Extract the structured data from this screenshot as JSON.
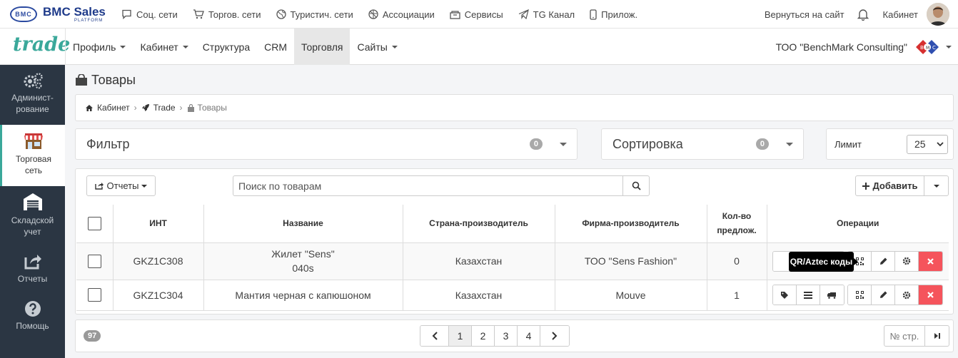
{
  "topbar": {
    "brand": "BMC Sales",
    "brand_sub": "PLATFORM",
    "brand_badge": "BMC",
    "nav": [
      {
        "label": "Соц. сети",
        "icon": "chat-icon"
      },
      {
        "label": "Торгов. сети",
        "icon": "cart-icon"
      },
      {
        "label": "Туристич. сети",
        "icon": "globe-icon"
      },
      {
        "label": "Ассоциации",
        "icon": "network-icon"
      },
      {
        "label": "Сервисы",
        "icon": "box-icon"
      },
      {
        "label": "TG Канал",
        "icon": "telegram-icon"
      },
      {
        "label": "Прилож.",
        "icon": "phone-icon"
      }
    ],
    "back_to_site": "Вернуться на сайт",
    "cabinet": "Кабинет"
  },
  "mainnav": {
    "logo": "trade",
    "tabs": [
      {
        "label": "Профиль",
        "dropdown": true
      },
      {
        "label": "Кабинет",
        "dropdown": true
      },
      {
        "label": "Структура",
        "dropdown": false
      },
      {
        "label": "CRM",
        "dropdown": false
      },
      {
        "label": "Торговля",
        "dropdown": false,
        "active": true
      },
      {
        "label": "Сайты",
        "dropdown": true
      }
    ],
    "company": "ТОО \"BenchMark Consulting\"",
    "company_logo": "B M C"
  },
  "sidebar": {
    "items": [
      {
        "label": "Админист-рование",
        "icon": "gears-icon"
      },
      {
        "label": "Торговая сеть",
        "icon": "store-icon",
        "active": true
      },
      {
        "label": "Складской учет",
        "icon": "warehouse-icon"
      },
      {
        "label": "Отчеты",
        "icon": "share-icon"
      },
      {
        "label": "Помощь",
        "icon": "help-icon"
      }
    ]
  },
  "page": {
    "title": "Товары",
    "breadcrumb": [
      "Кабинет",
      "Trade",
      "Товары"
    ]
  },
  "filter": {
    "label": "Фильтр",
    "count": "0"
  },
  "sort": {
    "label": "Сортировка",
    "count": "0"
  },
  "limit": {
    "label": "Лимит",
    "value": "25"
  },
  "toolbar": {
    "reports": "Отчеты",
    "search_placeholder": "Поиск по товарам",
    "add": "Добавить"
  },
  "table": {
    "headers": [
      "ИНТ",
      "Название",
      "Страна-производитель",
      "Фирма-производитель",
      "Кол-во предлож.",
      "Операции"
    ],
    "rows": [
      {
        "int": "GKZ1C308",
        "name": "Жилет \"Sens\"",
        "name2": "040s",
        "country": "Казахстан",
        "firm": "ТОО \"Sens Fashion\"",
        "offers": "0"
      },
      {
        "int": "GKZ1C304",
        "name": "Мантия черная с капюшоном",
        "name2": "",
        "country": "Казахстан",
        "firm": "Mouve",
        "offers": "1"
      }
    ],
    "tooltip": "QR/Aztec коды"
  },
  "pagination": {
    "total": "97",
    "pages": [
      "1",
      "2",
      "3",
      "4"
    ],
    "current": "1",
    "goto_placeholder": "№ стр."
  },
  "colors": {
    "accent": "#3aa89a",
    "sidebar": "#2b3643",
    "danger": "#f5545c"
  }
}
